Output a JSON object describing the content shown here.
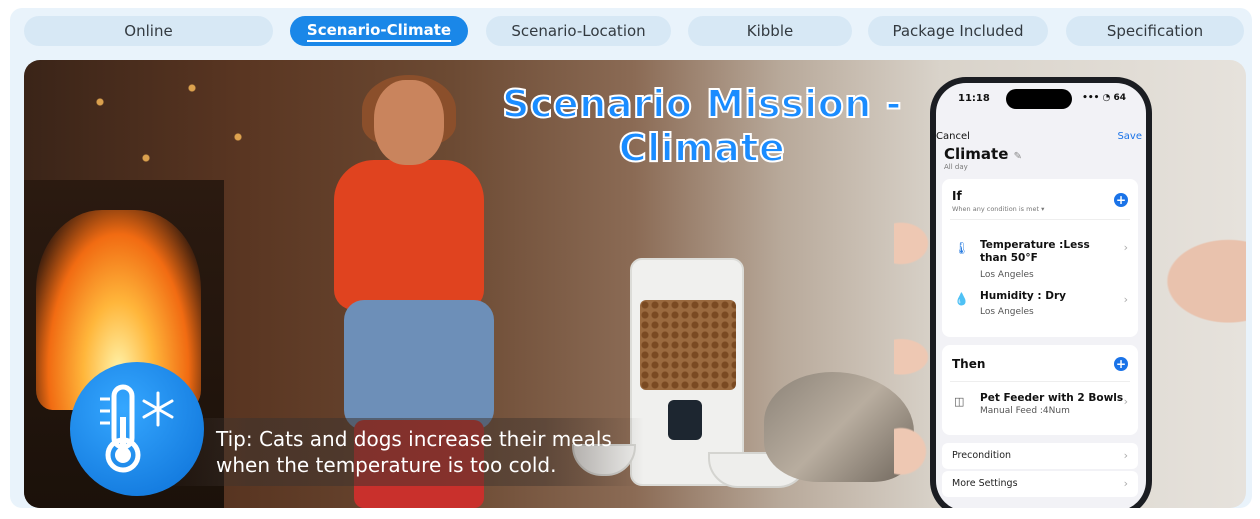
{
  "tabs": [
    {
      "label": "Online",
      "active": false
    },
    {
      "label": "Scenario-Climate",
      "active": true
    },
    {
      "label": "Scenario-Location",
      "active": false
    },
    {
      "label": "Kibble",
      "active": false
    },
    {
      "label": "Package Included",
      "active": false
    },
    {
      "label": "Specification",
      "active": false
    }
  ],
  "hero": {
    "title": "Scenario Mission - Climate",
    "tip_line1": "Tip: Cats and dogs increase their meals",
    "tip_line2": "when the temperature is too cold."
  },
  "phone": {
    "time": "11:18",
    "status_icons": "••• ◔ 64",
    "cancel": "Cancel",
    "save": "Save",
    "scene_title": "Climate",
    "scene_subtitle": "All day",
    "if_section": {
      "heading": "If",
      "subheading": "When any condition is met ▾",
      "conditions": [
        {
          "title": "Temperature :Less than 50°F",
          "location": "Los Angeles",
          "icon": "thermometer-icon"
        },
        {
          "title": "Humidity : Dry",
          "location": "Los Angeles",
          "icon": "water-drop-icon"
        }
      ]
    },
    "then_section": {
      "heading": "Then",
      "action_title": "Pet Feeder with 2 Bowls",
      "action_sub": "Manual Feed :4Num"
    },
    "precondition": "Precondition",
    "more_settings": "More Settings"
  },
  "colors": {
    "accent": "#1a87e8",
    "tab_bg": "#d7e8f5",
    "title_blue": "#1a8cff"
  }
}
